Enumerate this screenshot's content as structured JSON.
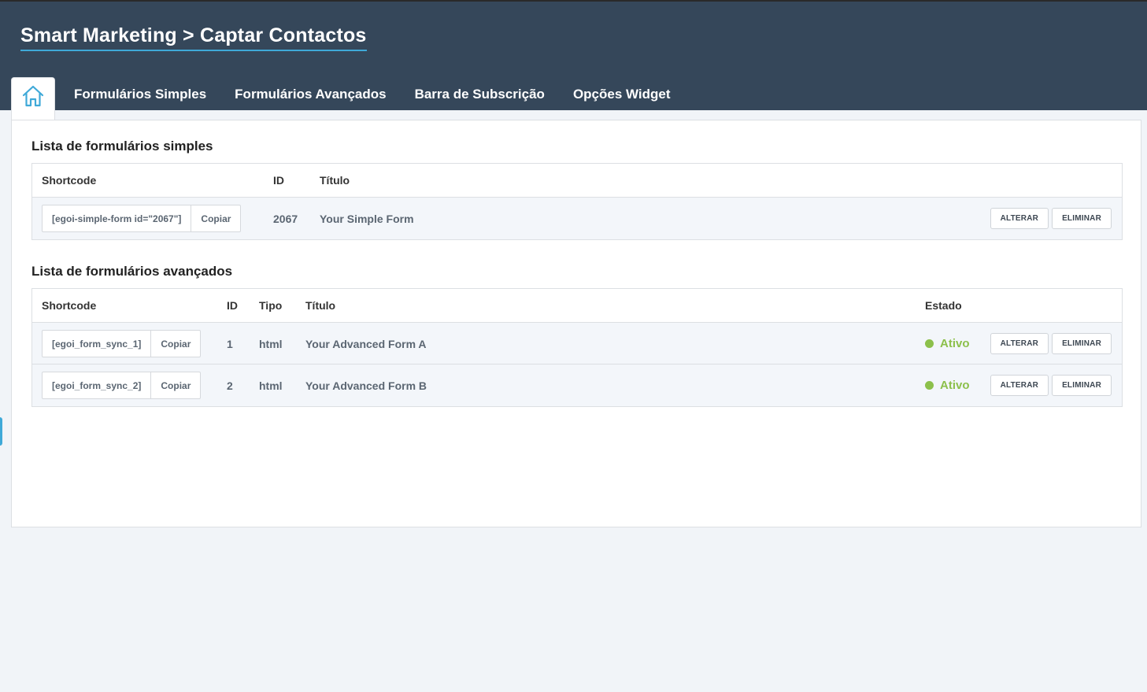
{
  "header": {
    "title": "Smart Marketing > Captar Contactos"
  },
  "tabs": [
    {
      "label": "Formulários Simples"
    },
    {
      "label": "Formulários Avançados"
    },
    {
      "label": "Barra de Subscrição"
    },
    {
      "label": "Opções Widget"
    }
  ],
  "simple": {
    "title": "Lista de formulários simples",
    "headers": {
      "shortcode": "Shortcode",
      "id": "ID",
      "title": "Título"
    },
    "rows": [
      {
        "shortcode": "[egoi-simple-form id=\"2067\"]",
        "copy": "Copiar",
        "id": "2067",
        "title": "Your Simple Form",
        "edit": "ALTERAR",
        "delete": "ELIMINAR"
      }
    ]
  },
  "advanced": {
    "title": "Lista de formulários avançados",
    "headers": {
      "shortcode": "Shortcode",
      "id": "ID",
      "type": "Tipo",
      "title": "Título",
      "status": "Estado"
    },
    "rows": [
      {
        "shortcode": "[egoi_form_sync_1]",
        "copy": "Copiar",
        "id": "1",
        "type": "html",
        "title": "Your Advanced Form A",
        "status": "Ativo",
        "edit": "ALTERAR",
        "delete": "ELIMINAR"
      },
      {
        "shortcode": "[egoi_form_sync_2]",
        "copy": "Copiar",
        "id": "2",
        "type": "html",
        "title": "Your Advanced Form B",
        "status": "Ativo",
        "edit": "ALTERAR",
        "delete": "ELIMINAR"
      }
    ]
  },
  "colors": {
    "header_bg": "#35475a",
    "accent": "#3fa9d8",
    "status_active": "#8cc04b"
  },
  "icons": {
    "home_tab": "home-icon",
    "status": "status-dot-icon"
  }
}
